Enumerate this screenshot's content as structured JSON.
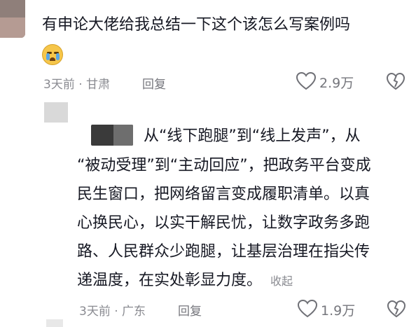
{
  "comment1": {
    "text": "有申论大佬给我总结一下这个该怎么写案例吗",
    "meta": "3天前 · 甘肃",
    "reply_label": "回复",
    "likes": "2.9万"
  },
  "comment2": {
    "lines": [
      "从“线下跑腿”到“线上发声”，从",
      "“被动受理”到“主动回应”，把政务平台变成",
      "民生窗口，把网络留言变成履职清单。以真",
      "心换民心，以实干解民忧，让数字政务多跑",
      "路、人民群众少跑腿，让基层治理在指尖传",
      "递温度，在实处彰显力度。"
    ],
    "collapse_label": "收起",
    "meta": "3天前 · 广东",
    "reply_label": "回复",
    "likes": "1.9万"
  },
  "icons": [
    "crying-emoji-icon",
    "heart-icon",
    "dislike-icon"
  ]
}
